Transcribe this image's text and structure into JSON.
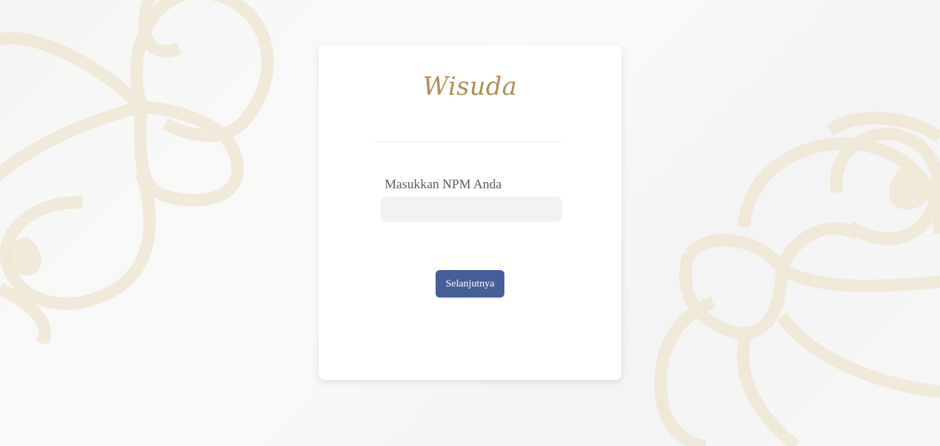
{
  "logo": {
    "text": "Wisuda"
  },
  "form": {
    "npm_label": "Masukkan NPM Anda",
    "npm_value": "",
    "npm_placeholder": "",
    "next_button_label": "Selanjutnya"
  },
  "colors": {
    "accent_gold": "#b08e55",
    "button_blue": "#455f98",
    "ornament": "#efe6d3"
  }
}
